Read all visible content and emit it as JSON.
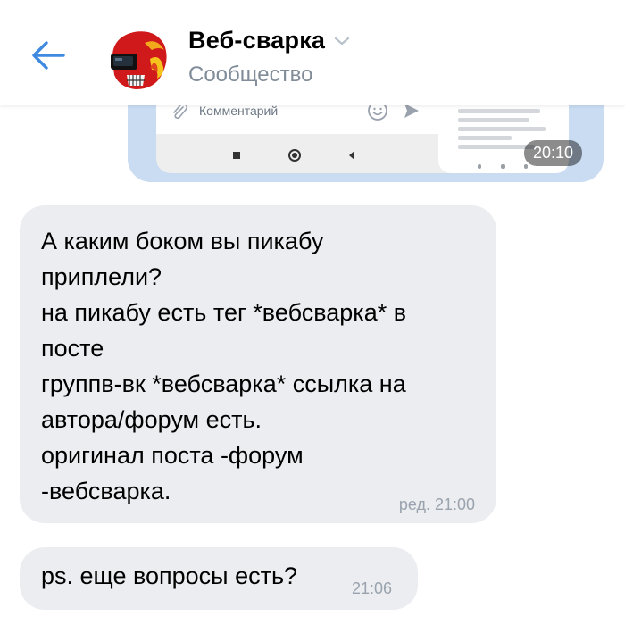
{
  "header": {
    "title": "Веб-сварка",
    "subtitle": "Сообщество",
    "back_icon": "arrow-left-icon",
    "dropdown_icon": "chevron-down-icon"
  },
  "attachment": {
    "comment_placeholder": "Комментарий",
    "time": "20:10"
  },
  "messages": [
    {
      "text": "А каким боком вы пикабу\nприплели?\nна пикабу есть тег *вебсварка* в\nпосте\nгруппв-вк *вебсварка* ссылка на\nавтора/форум есть.\nоригинал поста -форум\n-вебсварка.",
      "time": "ред. 21:00"
    },
    {
      "text": "ps. еще вопросы есть?",
      "time": "21:06"
    }
  ],
  "colors": {
    "accent": "#3f8ae0",
    "bubble": "#ebedf0",
    "attachment_bg": "#c9dcf2",
    "secondary_text": "#818c99"
  }
}
